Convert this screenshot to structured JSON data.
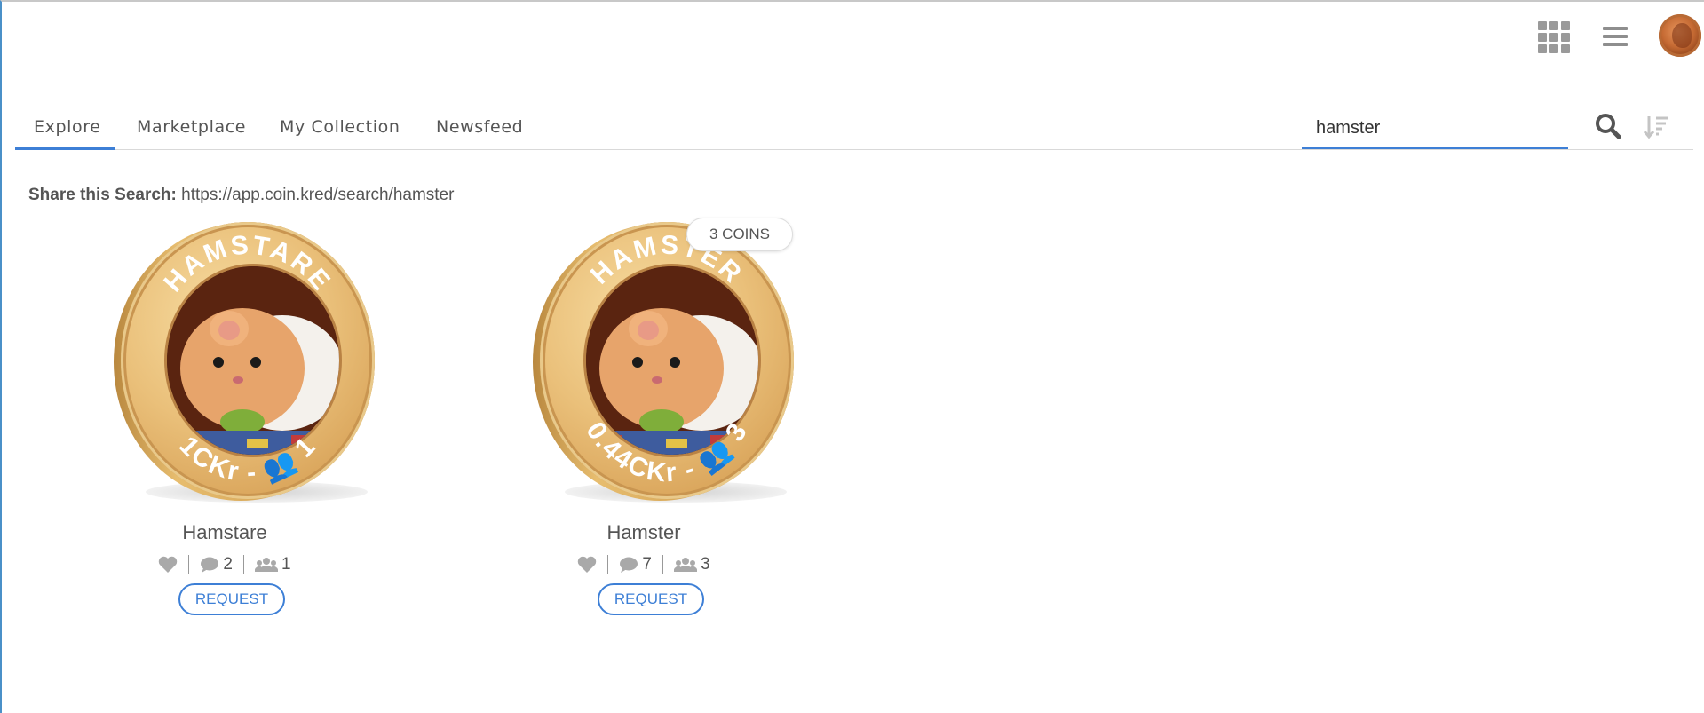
{
  "header": {
    "apps_icon": "grid-icon",
    "menu_icon": "hamburger-icon",
    "avatar_icon": "penny-coin-avatar"
  },
  "nav": {
    "tabs": [
      {
        "label": "Explore",
        "active": true
      },
      {
        "label": "Marketplace",
        "active": false
      },
      {
        "label": "My Collection",
        "active": false
      },
      {
        "label": "Newsfeed",
        "active": false
      }
    ]
  },
  "search": {
    "value": "hamster",
    "search_icon": "search-icon",
    "sort_icon": "sort-icon"
  },
  "share": {
    "label": "Share this Search:",
    "url": "https://app.coin.kred/search/hamster"
  },
  "coins": [
    {
      "ring_title": "HAMSTARE",
      "ring_value": "1CKr - ",
      "ring_holders": "1",
      "name": "Hamstare",
      "comments": "2",
      "holders": "1",
      "button": "REQUEST",
      "badge": ""
    },
    {
      "ring_title": "HAMSTER",
      "ring_value": "0.44CKr - ",
      "ring_holders": "3",
      "name": "Hamster",
      "comments": "7",
      "holders": "3",
      "button": "REQUEST",
      "badge": "3 COINS"
    }
  ],
  "colors": {
    "accent": "#3d7fd6",
    "text": "#555555",
    "coin_gold": "#e7bd6f"
  }
}
